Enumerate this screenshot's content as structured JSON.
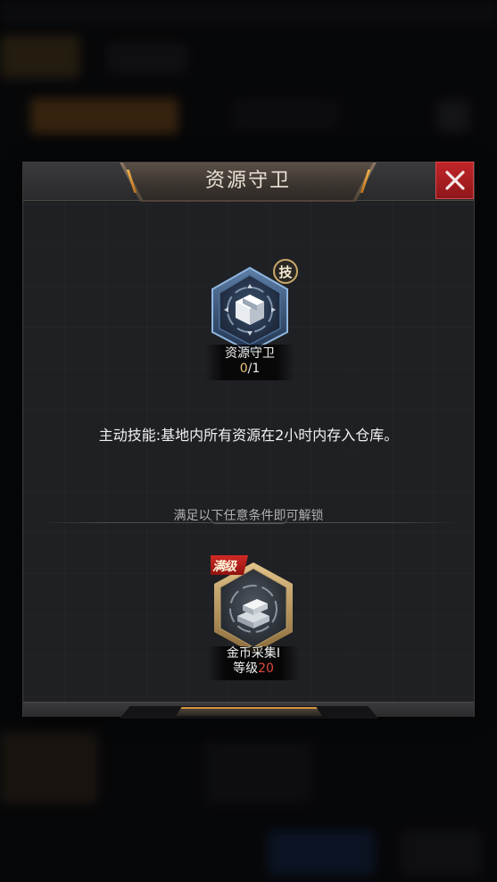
{
  "dialog": {
    "title": "资源守卫",
    "close_icon": "close-icon"
  },
  "skill": {
    "icon": "box-shield-icon",
    "tech_badge": "技",
    "name": "资源守卫",
    "progress_current": "0",
    "progress_total": "/1",
    "description": "主动技能:基地内所有资源在2小时内存入仓库。"
  },
  "unlock": {
    "hint": "满足以下任意条件即可解锁",
    "requirement": {
      "badge": "满级",
      "icon": "gold-bars-icon",
      "name": "金币采集I",
      "level_label": "等级",
      "level_value": "20"
    }
  },
  "colors": {
    "accent_orange": "#e9a04a",
    "close_red": "#b41f23",
    "level_red": "#e04a3c",
    "progress_gold": "#e9c07a"
  }
}
